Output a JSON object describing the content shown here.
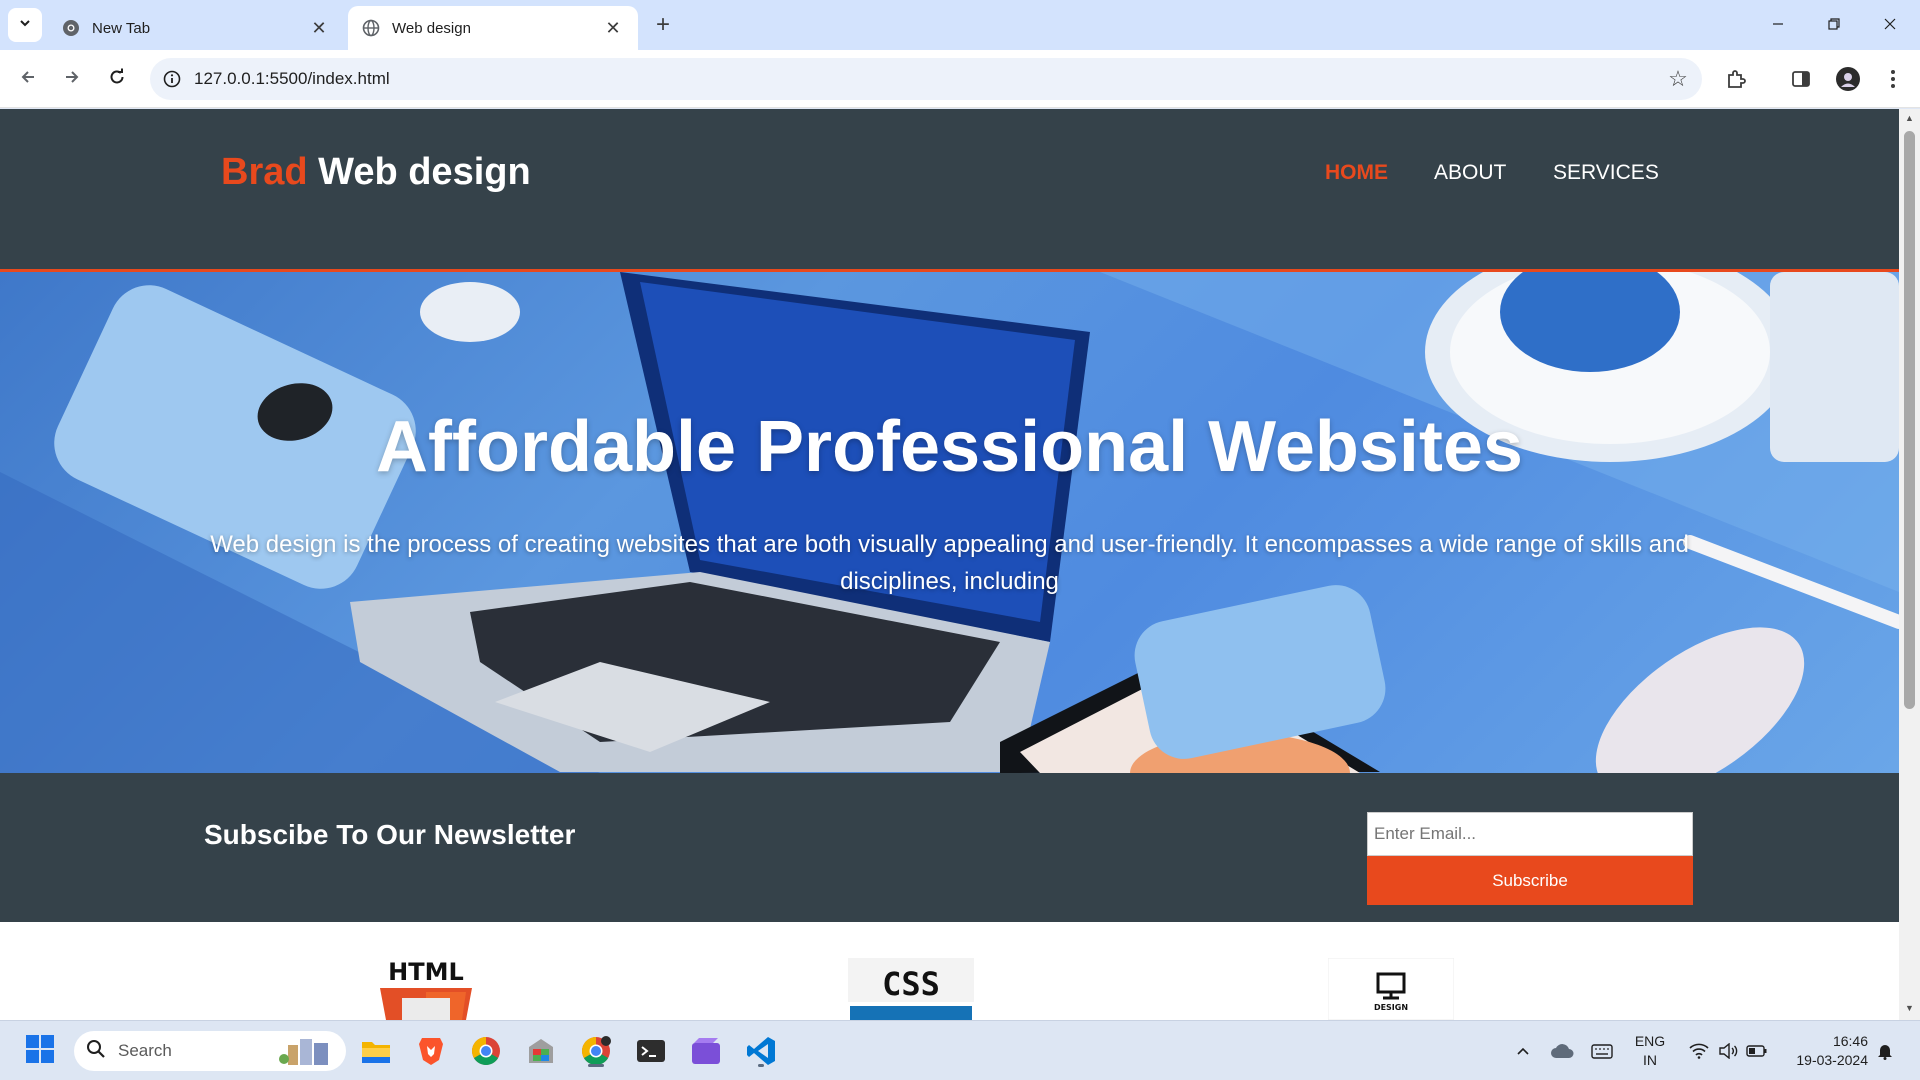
{
  "browser": {
    "tabs": [
      {
        "title": "New Tab",
        "active": false
      },
      {
        "title": "Web design",
        "active": true
      }
    ],
    "url": "127.0.0.1:5500/index.html",
    "icons": {
      "tab_search": "chevron-down-icon",
      "new_tab": "plus-icon",
      "back": "arrow-left-icon",
      "forward": "arrow-right-icon",
      "reload": "reload-icon",
      "site_info": "info-icon",
      "bookmark": "star-icon",
      "extensions": "puzzle-icon",
      "side_panel": "side-panel-icon",
      "menu": "kebab-menu-icon"
    }
  },
  "site": {
    "brand_highlight": "Brad",
    "brand_rest": " Web design",
    "nav": [
      {
        "label": "Home",
        "current": true
      },
      {
        "label": "About",
        "current": false
      },
      {
        "label": "Services",
        "current": false
      }
    ],
    "showcase": {
      "title": "Affordable Professional Websites",
      "text": "Web design is the process of creating websites that are both visually appealing and user-friendly. It encompasses a wide range of skills and disciplines, including"
    },
    "newsletter": {
      "title": "Subscibe To Our Newsletter",
      "email_placeholder": "Enter Email...",
      "button": "Subscribe"
    },
    "boxes": [
      {
        "logo_text": "HTML"
      },
      {
        "logo_text": "CSS"
      },
      {
        "logo_text": "DESIGN"
      }
    ],
    "colors": {
      "accent": "#e8491d",
      "dark": "#35424a",
      "white": "#ffffff"
    }
  },
  "taskbar": {
    "search_label": "Search",
    "apps": [
      "file-explorer-icon",
      "brave-icon",
      "chrome-icon",
      "photos-icon",
      "chrome-active-icon",
      "terminal-icon",
      "clipchamp-icon",
      "vscode-icon"
    ],
    "language": {
      "line1": "ENG",
      "line2": "IN"
    },
    "time": "16:46",
    "date": "19-03-2024"
  }
}
